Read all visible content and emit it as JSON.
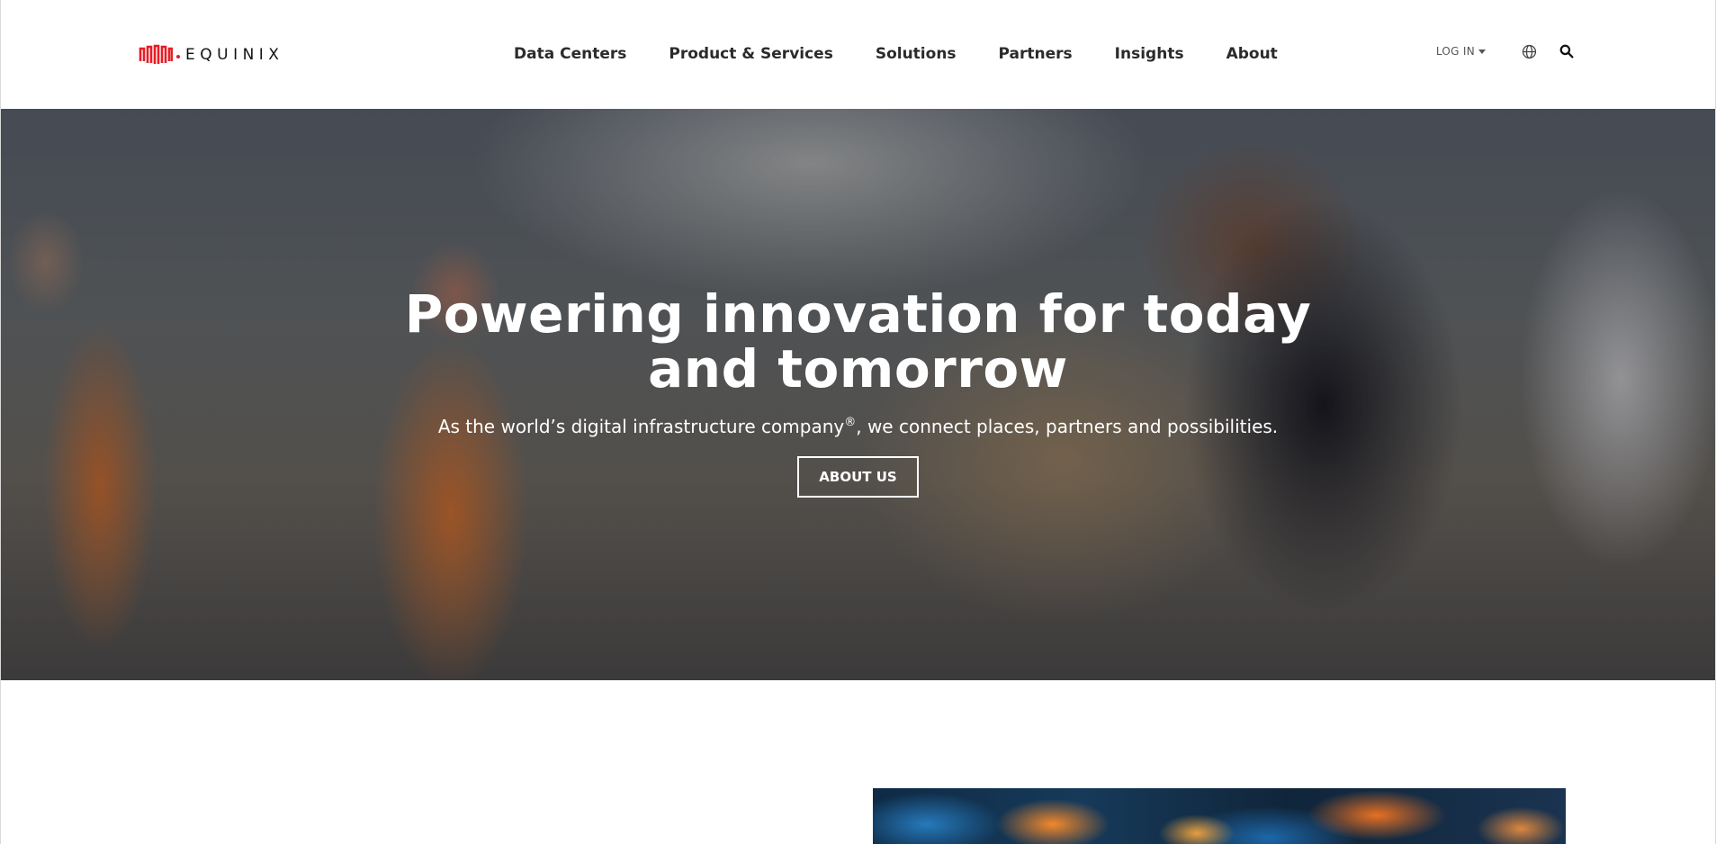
{
  "brand": {
    "name": "EQUINIX",
    "logo_icon": "equinix-logo-mark",
    "accent_color": "#e91c24"
  },
  "nav": {
    "items": [
      {
        "label": "Data Centers"
      },
      {
        "label": "Product & Services"
      },
      {
        "label": "Solutions"
      },
      {
        "label": "Partners"
      },
      {
        "label": "Insights"
      },
      {
        "label": "About"
      }
    ]
  },
  "utils": {
    "login_label": "LOG IN",
    "language_icon": "globe-icon",
    "search_icon": "search-icon"
  },
  "hero": {
    "title_line1": "Powering innovation for today",
    "title_line2": "and tomorrow",
    "subtitle_before": "As the world’s digital infrastructure company",
    "subtitle_mark": "®",
    "subtitle_after": ", we connect places, partners and possibilities.",
    "button_label": "ABOUT US"
  }
}
